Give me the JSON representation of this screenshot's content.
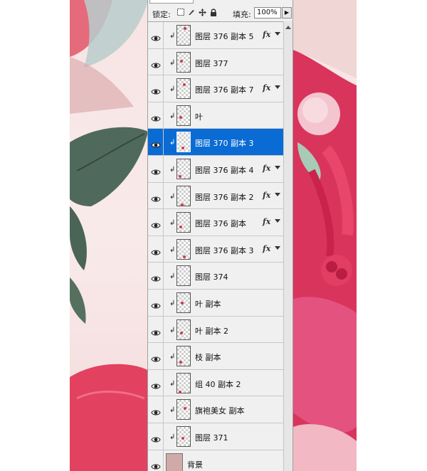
{
  "panel": {
    "lock_label": "锁定:",
    "lock_icons": [
      "lock-transparent-pixels-icon",
      "lock-image-pixels-icon",
      "lock-position-icon",
      "lock-all-icon"
    ],
    "fill_label": "填充:",
    "fill_value": "100%"
  },
  "layers": [
    {
      "name": "图层 376 副本 5",
      "fx": "fx",
      "clipped": true,
      "selected": false
    },
    {
      "name": "图层 377",
      "fx": "",
      "clipped": true,
      "selected": false
    },
    {
      "name": "图层 376 副本 7",
      "fx": "fx",
      "clipped": true,
      "selected": false
    },
    {
      "name": "叶",
      "fx": "",
      "clipped": true,
      "selected": false
    },
    {
      "name": "图层 370 副本 3",
      "fx": "",
      "clipped": true,
      "selected": true
    },
    {
      "name": "图层 376 副本 4",
      "fx": "fx",
      "clipped": true,
      "selected": false
    },
    {
      "name": "图层 376 副本 2",
      "fx": "fx",
      "clipped": true,
      "selected": false
    },
    {
      "name": "图层 376 副本",
      "fx": "fx",
      "clipped": true,
      "selected": false
    },
    {
      "name": "图层 376 副本 3",
      "fx": "fx",
      "clipped": true,
      "selected": false
    },
    {
      "name": "图层 374",
      "fx": "",
      "clipped": true,
      "selected": false
    },
    {
      "name": "叶 副本",
      "fx": "",
      "clipped": true,
      "selected": false
    },
    {
      "name": "叶 副本 2",
      "fx": "",
      "clipped": true,
      "selected": false
    },
    {
      "name": "枝 副本",
      "fx": "",
      "clipped": true,
      "selected": false
    },
    {
      "name": "组 40 副本 2",
      "fx": "",
      "clipped": true,
      "selected": false
    },
    {
      "name": "旗袍美女 副本",
      "fx": "",
      "clipped": true,
      "selected": false
    },
    {
      "name": "图层 371",
      "fx": "",
      "clipped": true,
      "selected": false
    },
    {
      "name": "背景",
      "fx": "",
      "clipped": false,
      "selected": false,
      "background": true
    }
  ],
  "colors": {
    "selection": "#0a6bd4",
    "panel_bg": "#f0f0f0",
    "art_pink": "#e0375e",
    "leaf_green": "#4f6a5c"
  }
}
